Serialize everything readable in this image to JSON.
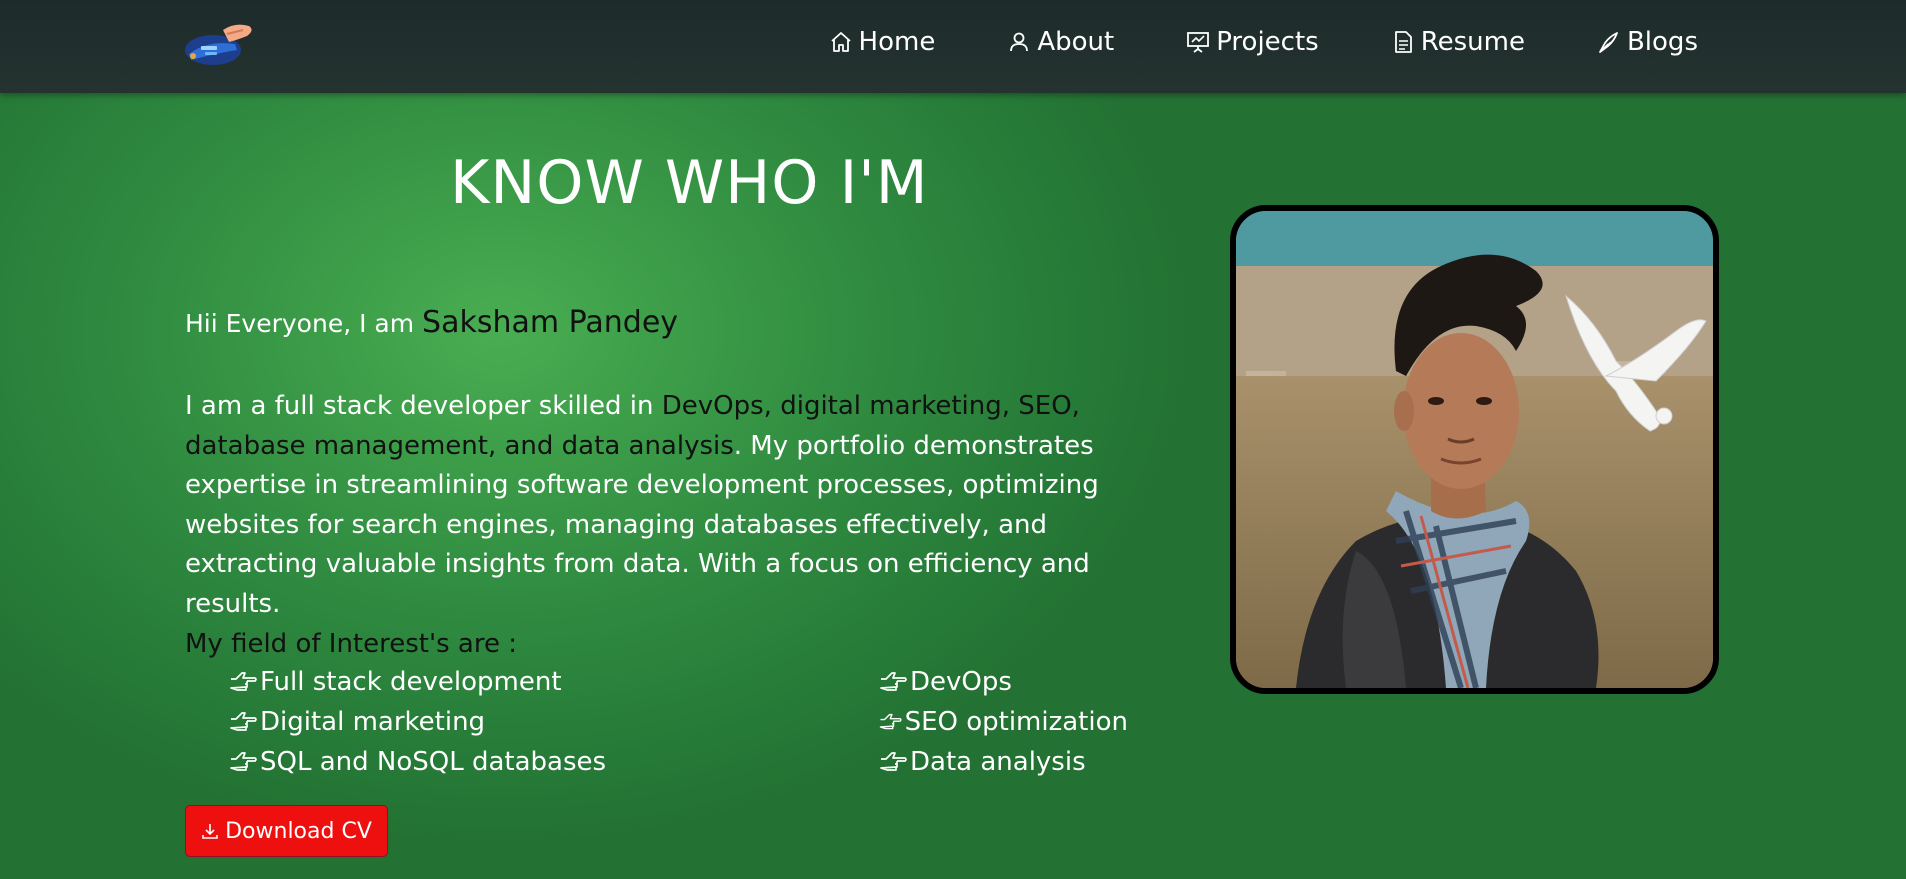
{
  "nav": {
    "items": [
      {
        "label": "Home",
        "icon": "home-icon"
      },
      {
        "label": "About",
        "icon": "user-icon"
      },
      {
        "label": "Projects",
        "icon": "presentation-icon"
      },
      {
        "label": "Resume",
        "icon": "document-icon"
      },
      {
        "label": "Blogs",
        "icon": "pen-icon"
      }
    ]
  },
  "hero": {
    "heading": "KNOW WHO I'M",
    "greeting_prefix": "Hii Everyone, I am ",
    "name": "Saksham Pandey",
    "bio_start": "I am a full stack developer skilled in ",
    "bio_highlight": "DevOps, digital marketing, SEO, database management, and data analysis",
    "bio_end": ". My portfolio demonstrates expertise in streamlining software development processes, optimizing websites for search engines, managing databases effectively, and extracting valuable insights from data. With a focus on efficiency and results.",
    "interests_title": "My field of Interest's are :",
    "interests": [
      "Full stack development",
      "DevOps",
      "Digital marketing",
      "SEO optimization",
      "SQL and NoSQL databases",
      "Data analysis"
    ],
    "download_label": "Download CV"
  },
  "colors": {
    "nav_bg": "#1f2d2c",
    "page_green": "#3a9a47",
    "button_red": "#ee0f0f",
    "highlight_text": "#111111"
  }
}
